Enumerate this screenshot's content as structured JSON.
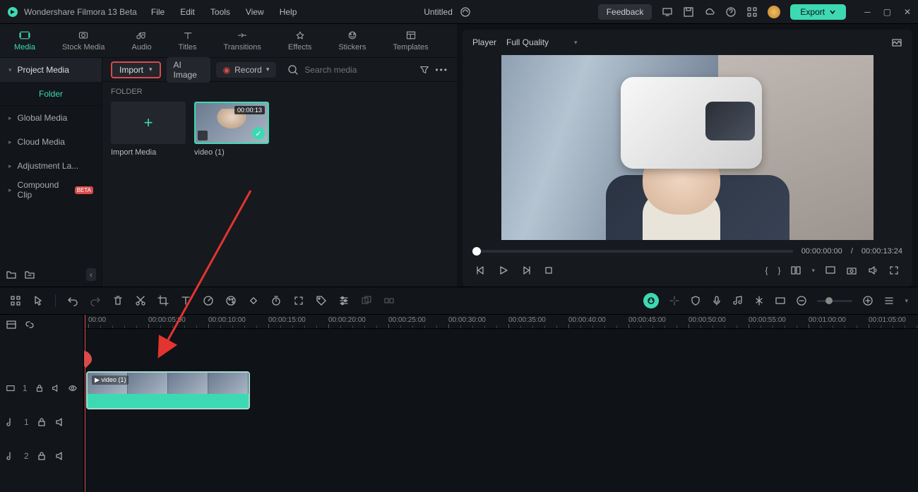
{
  "app": {
    "title": "Wondershare Filmora 13 Beta",
    "doc_title": "Untitled"
  },
  "menu": [
    "File",
    "Edit",
    "Tools",
    "View",
    "Help"
  ],
  "title_right": {
    "feedback": "Feedback",
    "export": "Export"
  },
  "tabs": [
    {
      "label": "Media",
      "active": true
    },
    {
      "label": "Stock Media"
    },
    {
      "label": "Audio"
    },
    {
      "label": "Titles"
    },
    {
      "label": "Transitions"
    },
    {
      "label": "Effects"
    },
    {
      "label": "Stickers"
    },
    {
      "label": "Templates"
    }
  ],
  "sidebar": {
    "project_media": "Project Media",
    "folder": "Folder",
    "items": [
      {
        "label": "Global Media"
      },
      {
        "label": "Cloud Media"
      },
      {
        "label": "Adjustment La..."
      },
      {
        "label": "Compound Clip",
        "beta": "BETA"
      }
    ]
  },
  "toolbar": {
    "import": "Import",
    "ai_image": "AI Image",
    "record": "Record",
    "search_placeholder": "Search media"
  },
  "media_grid": {
    "folder_label": "FOLDER",
    "import_label": "Import Media",
    "clip_name": "video (1)",
    "clip_dur": "00:00:13"
  },
  "preview": {
    "player": "Player",
    "quality": "Full Quality",
    "time_current": "00:00:00:00",
    "time_sep": "/",
    "time_total": "00:00:13:24",
    "brace_l": "{",
    "brace_r": "}"
  },
  "timeline": {
    "ruler": [
      "00:00",
      "00:00:05:00",
      "00:00:10:00",
      "00:00:15:00",
      "00:00:20:00",
      "00:00:25:00",
      "00:00:30:00",
      "00:00:35:00",
      "00:00:40:00",
      "00:00:45:00",
      "00:00:50:00",
      "00:00:55:00",
      "00:01:00:00",
      "00:01:05:00"
    ],
    "clip_label": "▶ video (1)",
    "track_v": "1",
    "track_a1": "1",
    "track_a2": "2"
  }
}
